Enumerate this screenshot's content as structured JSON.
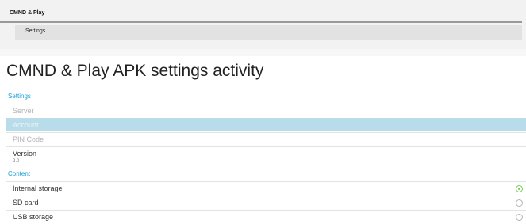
{
  "breadcrumb": {
    "title": "CMND & Play",
    "sub": "Settings"
  },
  "page_title": "CMND & Play APK settings activity",
  "settings_section": {
    "header": "Settings",
    "items": [
      {
        "label": "Server",
        "state": "disabled"
      },
      {
        "label": "Account",
        "state": "selected"
      },
      {
        "label": "PIN Code",
        "state": "disabled"
      },
      {
        "label": "Version",
        "value": "2.0",
        "state": "normal"
      }
    ]
  },
  "content_section": {
    "header": "Content",
    "items": [
      {
        "label": "Internal storage",
        "checked": true
      },
      {
        "label": "SD card",
        "checked": false
      },
      {
        "label": "USB storage",
        "checked": false
      }
    ]
  },
  "colors": {
    "accent": "#1a9fd9",
    "selected_row": "#b9dceb",
    "radio_checked": "#7bcf57"
  }
}
